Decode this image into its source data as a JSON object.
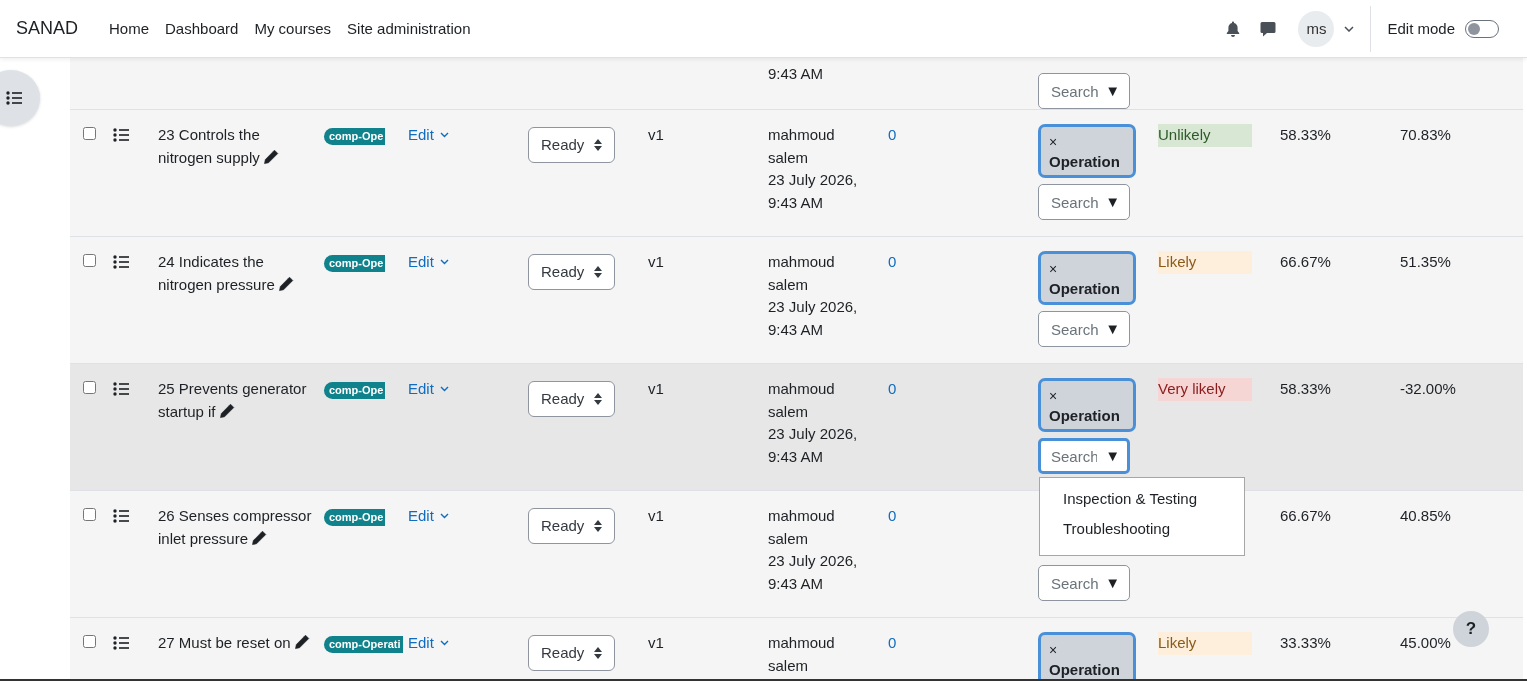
{
  "navbar": {
    "brand": "SANAD",
    "links": [
      {
        "label": "Home"
      },
      {
        "label": "Dashboard"
      },
      {
        "label": "My courses"
      },
      {
        "label": "Site administration"
      }
    ],
    "avatar": "ms",
    "edit_mode": {
      "label": "Edit mode",
      "on": false
    }
  },
  "partial_row": {
    "date": "9:43 AM",
    "search": {
      "placeholder": "Search",
      "toggle": "▼",
      "focused": false
    }
  },
  "rows": [
    {
      "checked": false,
      "hovered": false,
      "name": "23 Controls the nitrogen supply",
      "badge": "comp-Ope",
      "edit": "Edit",
      "status": "Ready",
      "version": "v1",
      "author": "mahmoud salem",
      "date": "23 July 2026, 9:43 AM",
      "count": "0",
      "tag": {
        "remove": "×",
        "label": "Operation"
      },
      "search": {
        "placeholder": "Search",
        "toggle": "▼",
        "focused": false
      },
      "likelihood": {
        "label": "Unlikely",
        "kind": "unlikely"
      },
      "pct_1": "58.33%",
      "pct_2": "70.83%"
    },
    {
      "checked": false,
      "hovered": false,
      "name": "24 Indicates the nitrogen pressure",
      "badge": "comp-Ope",
      "edit": "Edit",
      "status": "Ready",
      "version": "v1",
      "author": "mahmoud salem",
      "date": "23 July 2026, 9:43 AM",
      "count": "0",
      "tag": {
        "remove": "×",
        "label": "Operation"
      },
      "search": {
        "placeholder": "Search",
        "toggle": "▼",
        "focused": false
      },
      "likelihood": {
        "label": "Likely",
        "kind": "likely"
      },
      "pct_1": "66.67%",
      "pct_2": "51.35%"
    },
    {
      "checked": false,
      "hovered": true,
      "name": "25 Prevents generator startup if",
      "badge": "comp-Ope",
      "edit": "Edit",
      "status": "Ready",
      "version": "v1",
      "author": "mahmoud salem",
      "date": "23 July 2026, 9:43 AM",
      "count": "0",
      "tag": {
        "remove": "×",
        "label": "Operation"
      },
      "search": {
        "placeholder": "Search",
        "toggle": "▼",
        "focused": true
      },
      "likelihood": {
        "label": "Very likely",
        "kind": "very_likely"
      },
      "pct_1": "58.33%",
      "pct_2": "-32.00%"
    },
    {
      "checked": false,
      "hovered": false,
      "name": "26 Senses compressor inlet pressure",
      "badge": "comp-Ope",
      "edit": "Edit",
      "status": "Ready",
      "version": "v1",
      "author": "mahmoud salem",
      "date": "23 July 2026, 9:43 AM",
      "count": "0",
      "search": {
        "placeholder": "Search",
        "toggle": "▼",
        "focused": false
      },
      "pct_1": "66.67%",
      "pct_2": "40.85%"
    },
    {
      "checked": false,
      "hovered": false,
      "name": "27 Must be reset on",
      "badge": "comp-Operati",
      "edit": "Edit",
      "status": "Ready",
      "version": "v1",
      "author": "mahmoud salem",
      "count": "0",
      "tag": {
        "remove": "×",
        "label": "Operation"
      },
      "likelihood": {
        "label": "Likely",
        "kind": "likely"
      },
      "pct_1": "33.33%",
      "pct_2": "45.00%"
    }
  ],
  "dropdown": {
    "items": [
      {
        "label": "Inspection & Testing"
      },
      {
        "label": "Troubleshooting"
      }
    ]
  },
  "help_button": "?"
}
